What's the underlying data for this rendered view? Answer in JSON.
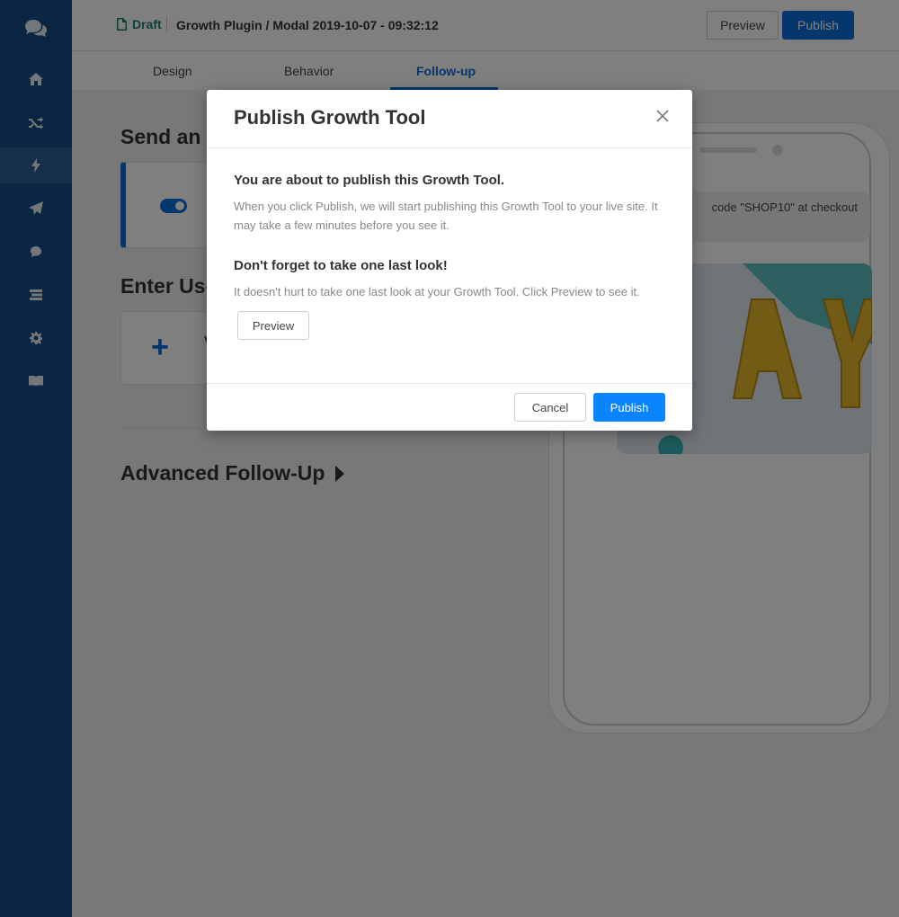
{
  "header": {
    "status": "Draft",
    "title": "Growth Plugin / Modal 2019-10-07 - 09:32:12",
    "preview_label": "Preview",
    "publish_label": "Publish"
  },
  "tabs": [
    {
      "label": "Design"
    },
    {
      "label": "Behavior"
    },
    {
      "label": "Follow-up",
      "active": true
    }
  ],
  "sidebar": {
    "icons": [
      "chat-bubbles-icon",
      "home-icon",
      "shuffle-icon",
      "bolt-icon",
      "paper-plane-icon",
      "chat-icon",
      "list-icon",
      "gear-icon",
      "book-icon"
    ],
    "active_index": 3
  },
  "main": {
    "section1_title": "Send an C",
    "section2_title": "Enter Use",
    "card2_letter": "V",
    "advanced_title": "Advanced Follow-Up"
  },
  "phone": {
    "message": "code \"SHOP10\" at checkout"
  },
  "modal": {
    "title": "Publish Growth Tool",
    "heading1": "You are about to publish this Growth Tool.",
    "text1": "When you click Publish, we will start publishing this Growth Tool to your live site. It may take a few minutes before you see it.",
    "heading2": "Don't forget to take one last look!",
    "text2": "It doesn't hurt to take one last look at your Growth Tool. Click Preview to see it.",
    "preview_label": "Preview",
    "cancel_label": "Cancel",
    "publish_label": "Publish"
  },
  "colors": {
    "sidebar": "#174c84",
    "accent": "#0a6fd8",
    "publish": "#0a84ff",
    "draft": "#1e7e6a"
  }
}
